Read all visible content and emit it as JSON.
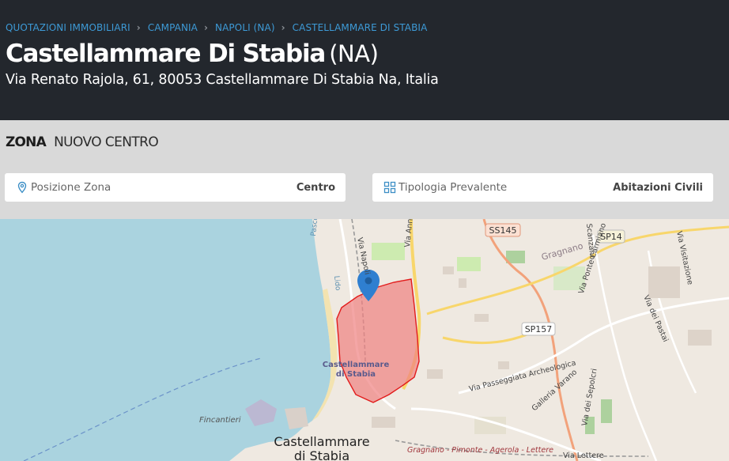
{
  "breadcrumb": {
    "items": [
      {
        "label": "QUOTAZIONI IMMOBILIARI"
      },
      {
        "label": "CAMPANIA"
      },
      {
        "label": "NAPOLI (NA)"
      },
      {
        "label": "CASTELLAMMARE DI STABIA"
      }
    ]
  },
  "header": {
    "title": "Castellammare Di Stabia",
    "province": "(NA)",
    "address": "Via Renato Rajola, 61, 80053 Castellammare Di Stabia Na, Italia"
  },
  "zona": {
    "label": "ZONA",
    "value": "NUOVO CENTRO"
  },
  "info": {
    "posizione": {
      "label": "Posizione Zona",
      "value": "Centro",
      "icon": "map-pin-icon"
    },
    "tipologia": {
      "label": "Tipologia Prevalente",
      "value": "Abitazioni Civili",
      "icon": "grid-icon"
    }
  },
  "map": {
    "labels": {
      "ss145": "SS145",
      "sp14": "SP14",
      "sp157": "SP157",
      "gragnano": "Gragnano",
      "zone_line1": "Castellammare",
      "zone_line2": "di Stabia",
      "city_line1": "Castellammare",
      "city_line2": "di Stabia",
      "fincantieri": "Fincantieri",
      "via_passeggiata": "Via Passeggiata Archeologica",
      "galleria": "Galleria Varano",
      "via_sepolcri": "Via dei Sepolcri",
      "via_ponte": "Via Ponte Carmiano",
      "via_pastai": "Via dei Pastai",
      "via_visitazione": "Via Visitazione",
      "via_napoli": "Via Napoli",
      "via_annunziatella": "Via Annunziatella",
      "railway": "Gragnano - Pimonte - Agerola - Lettere",
      "via_lettere": "Via Lettere",
      "scanzano": "Scanzano",
      "pascoli": "Pascoli",
      "lido": "Lido"
    },
    "colors": {
      "sea": "#aad3df",
      "zone_fill": "#f08080",
      "zone_stroke": "#e21b1b",
      "marker": "#2f7fd0"
    }
  }
}
